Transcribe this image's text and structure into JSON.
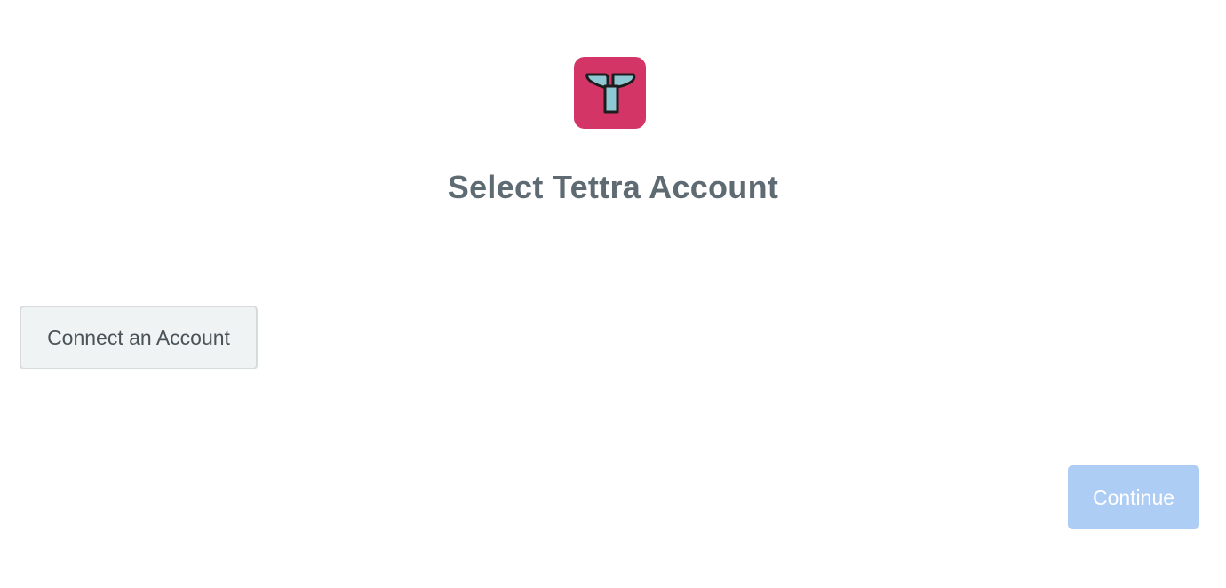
{
  "app": {
    "logo_icon": "tettra-logo-icon",
    "brand_color": "#d33566"
  },
  "header": {
    "title": "Select Tettra Account"
  },
  "actions": {
    "connect_label": "Connect an Account",
    "continue_label": "Continue",
    "continue_state": "disabled"
  },
  "colors": {
    "title_text": "#5f6b73",
    "connect_bg": "#f0f3f4",
    "continue_bg": "#aecdf5"
  }
}
